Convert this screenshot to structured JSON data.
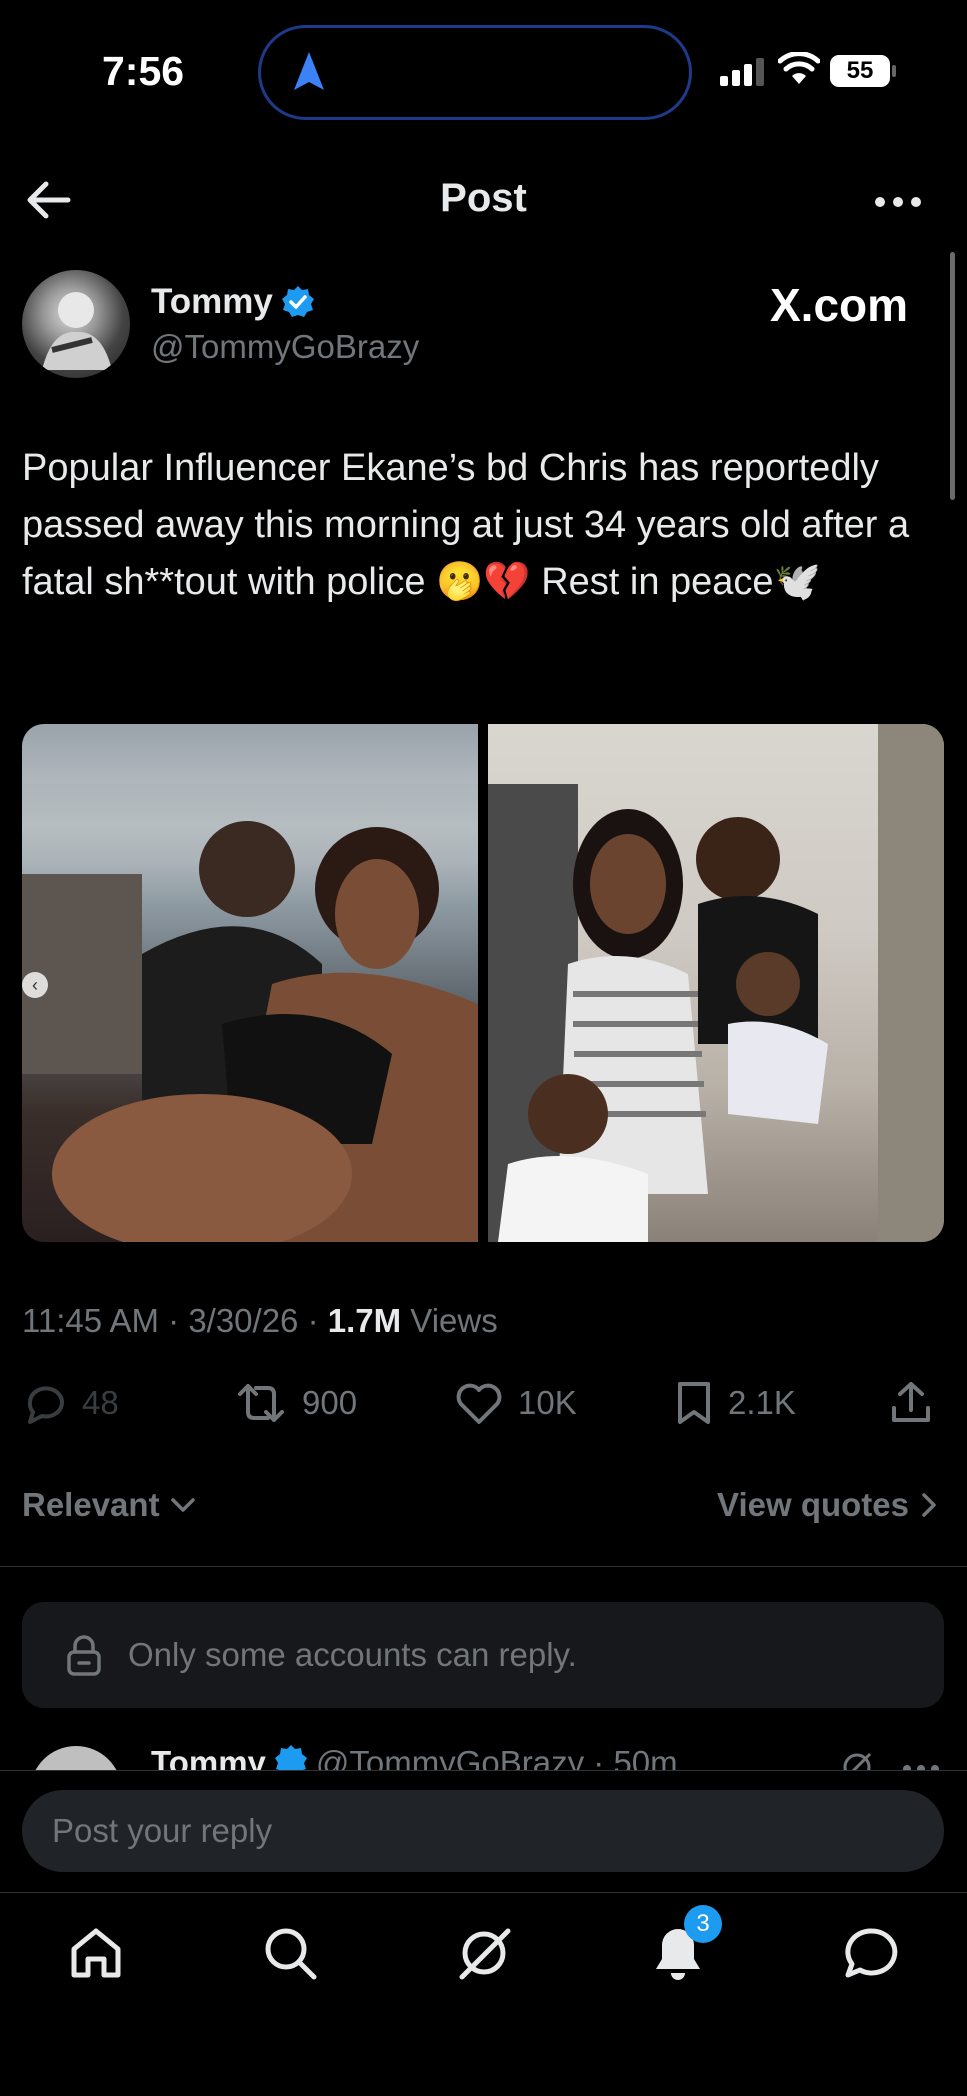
{
  "status_bar": {
    "time": "7:56",
    "battery": "55"
  },
  "header": {
    "title": "Post"
  },
  "author": {
    "name": "Tommy",
    "handle": "@TommyGoBrazy",
    "watermark": "X.com"
  },
  "tweet": {
    "text": "Popular Influencer Ekane’s bd Chris has reportedly passed away this morning at just 34 years old after a fatal sh**tout with police 🫢💔 Rest in peace🕊️"
  },
  "meta": {
    "time": "11:45 AM",
    "date": "3/30/26",
    "views_count": "1.7M",
    "views_label": "Views"
  },
  "actions": {
    "replies": "48",
    "reposts": "900",
    "likes": "10K",
    "bookmarks": "2.1K"
  },
  "sort": {
    "relevant_label": "Relevant",
    "view_quotes_label": "View quotes"
  },
  "notice": {
    "text": "Only some accounts can reply."
  },
  "reply_preview": {
    "name": "Tommy",
    "handle_time": "@TommyGoBrazy · 50m"
  },
  "reply": {
    "placeholder": "Post your reply"
  },
  "nav": {
    "notifications_badge": "3"
  },
  "colors": {
    "accent": "#1d9bf0",
    "muted": "#71767b",
    "text": "#e7e9ea",
    "background": "#000000"
  }
}
